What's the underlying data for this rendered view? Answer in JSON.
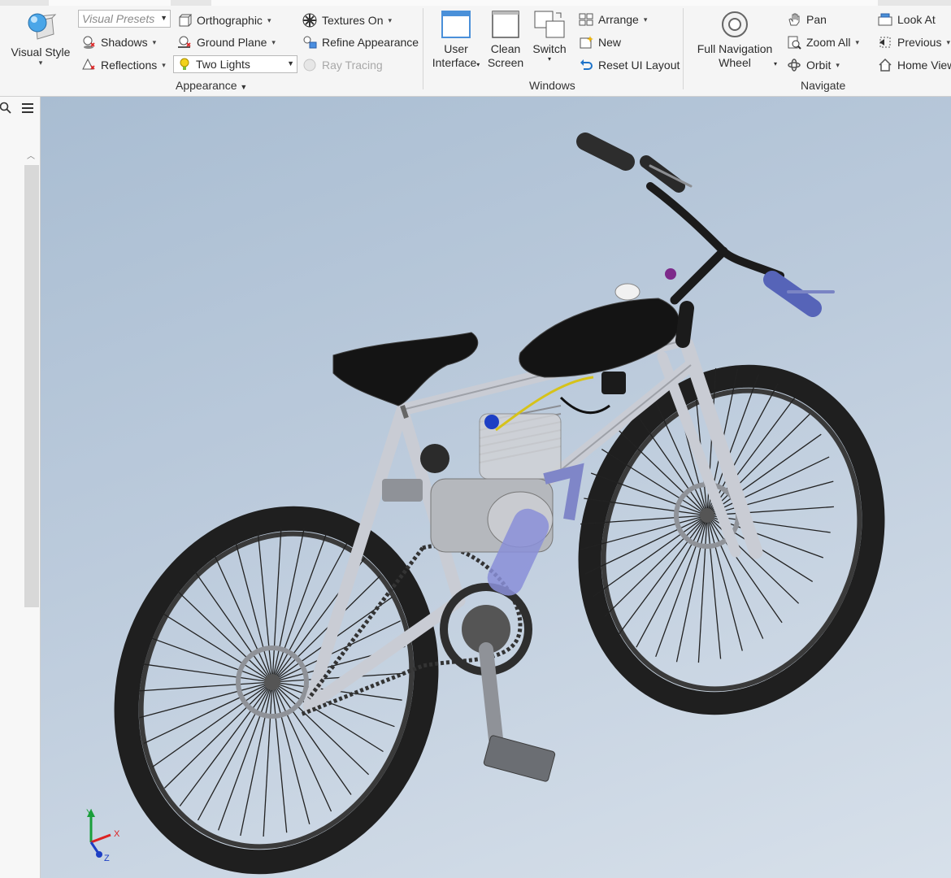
{
  "ribbon": {
    "appearance": {
      "title": "Appearance",
      "visual_style_label": "Visual Style",
      "visual_presets_placeholder": "Visual Presets",
      "shadows_label": "Shadows",
      "reflections_label": "Reflections",
      "orthographic_label": "Orthographic",
      "ground_plane_label": "Ground Plane",
      "lighting_value": "Two Lights",
      "textures_label": "Textures On",
      "refine_label": "Refine Appearance",
      "ray_tracing_label": "Ray Tracing"
    },
    "windows": {
      "title": "Windows",
      "user_interface_label_1": "User",
      "user_interface_label_2": "Interface",
      "clean_screen_label_1": "Clean",
      "clean_screen_label_2": "Screen",
      "switch_label": "Switch",
      "arrange_label": "Arrange",
      "new_label": "New",
      "reset_ui_label": "Reset UI Layout"
    },
    "navigate": {
      "title": "Navigate",
      "full_nav_label_1": "Full Navigation",
      "full_nav_label_2": "Wheel",
      "pan_label": "Pan",
      "zoom_all_label": "Zoom All",
      "orbit_label": "Orbit",
      "look_at_label": "Look At",
      "previous_label": "Previous",
      "home_view_label": "Home View"
    }
  },
  "viewcube_axes": {
    "x": "X",
    "y": "Y",
    "z": "Z"
  },
  "colors": {
    "frame": "#c9ccd4",
    "tire": "#1f1f1f",
    "saddle": "#141414",
    "engine": "#b5b8bd",
    "blue_accent": "#4a5ab8"
  }
}
